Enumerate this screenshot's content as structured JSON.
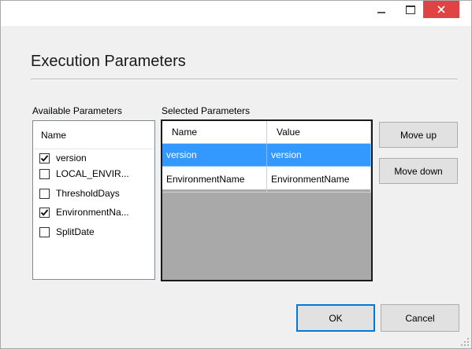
{
  "window": {
    "title": "",
    "controls": [
      "minimize-icon",
      "maximize-icon",
      "close-icon"
    ],
    "close_color": "#e04343"
  },
  "dialog": {
    "heading": "Execution Parameters"
  },
  "available": {
    "label": "Available Parameters",
    "column_header": "Name",
    "items": [
      {
        "label": "version",
        "checked": true
      },
      {
        "label": "LOCAL_ENVIR...",
        "checked": false
      },
      {
        "label": "ThresholdDays",
        "checked": false
      },
      {
        "label": "EnvironmentNa...",
        "checked": true
      },
      {
        "label": "SplitDate",
        "checked": false
      }
    ]
  },
  "selected": {
    "label": "Selected Parameters",
    "columns": [
      "Name",
      "Value"
    ],
    "rows": [
      {
        "name": "version",
        "value": "version",
        "selected": true
      },
      {
        "name": "EnvironmentName",
        "value": "EnvironmentName",
        "selected": false
      }
    ],
    "selection_color": "#3399ff"
  },
  "buttons": {
    "move_up": "Move up",
    "move_down": "Move down",
    "ok": "OK",
    "cancel": "Cancel"
  }
}
